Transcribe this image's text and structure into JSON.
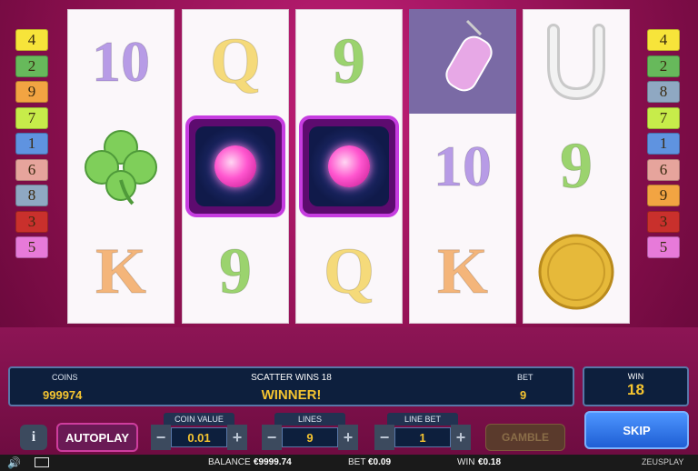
{
  "reels": [
    [
      {
        "kind": "text",
        "text": "10",
        "cls": "c10",
        "name": "symbol-10"
      },
      {
        "kind": "clover",
        "name": "clover-icon"
      },
      {
        "kind": "text",
        "text": "K",
        "cls": "cK",
        "name": "symbol-k"
      }
    ],
    [
      {
        "kind": "text",
        "text": "Q",
        "cls": "cQ",
        "name": "symbol-q"
      },
      {
        "kind": "scatter",
        "name": "crystal-ball-scatter-icon"
      },
      {
        "kind": "text",
        "text": "9",
        "cls": "c9",
        "name": "symbol-9"
      }
    ],
    [
      {
        "kind": "text",
        "text": "9",
        "cls": "c9",
        "name": "symbol-9"
      },
      {
        "kind": "scatter",
        "name": "crystal-ball-scatter-icon"
      },
      {
        "kind": "text",
        "text": "Q",
        "cls": "cQ",
        "name": "symbol-q"
      }
    ],
    [
      {
        "kind": "pendant",
        "name": "pendant-icon"
      },
      {
        "kind": "text",
        "text": "10",
        "cls": "c10",
        "name": "symbol-10"
      },
      {
        "kind": "text",
        "text": "K",
        "cls": "cK",
        "name": "symbol-k"
      }
    ],
    [
      {
        "kind": "horseshoe",
        "name": "horseshoe-icon"
      },
      {
        "kind": "text",
        "text": "9",
        "cls": "c9",
        "name": "symbol-9"
      },
      {
        "kind": "coin",
        "name": "gold-coin-icon"
      }
    ]
  ],
  "left_lines": [
    {
      "n": "4",
      "color": "#f7e43a"
    },
    {
      "n": "2",
      "color": "#67b95b"
    },
    {
      "n": "9",
      "color": "#f2a442"
    },
    {
      "n": "7",
      "color": "#c7ec4a"
    },
    {
      "n": "1",
      "color": "#5f93e0"
    },
    {
      "n": "6",
      "color": "#e6a49c"
    },
    {
      "n": "8",
      "color": "#8fa8c2"
    },
    {
      "n": "3",
      "color": "#c9302c"
    },
    {
      "n": "5",
      "color": "#e77ad9"
    }
  ],
  "right_lines": [
    {
      "n": "4",
      "color": "#f7e43a"
    },
    {
      "n": "2",
      "color": "#67b95b"
    },
    {
      "n": "8",
      "color": "#8fa8c2"
    },
    {
      "n": "7",
      "color": "#c7ec4a"
    },
    {
      "n": "1",
      "color": "#5f93e0"
    },
    {
      "n": "6",
      "color": "#e6a49c"
    },
    {
      "n": "9",
      "color": "#f2a442"
    },
    {
      "n": "3",
      "color": "#c9302c"
    },
    {
      "n": "5",
      "color": "#e77ad9"
    }
  ],
  "info": {
    "coins_label": "COINS",
    "coins_value": "999974",
    "scatter_text": "SCATTER WINS 18",
    "winner_text": "WINNER!",
    "bet_label": "BET",
    "bet_value": "9"
  },
  "win": {
    "label": "WIN",
    "value": "18"
  },
  "controls": {
    "info_label": "i",
    "autoplay": "AUTOPLAY",
    "coin_value_label": "COIN VALUE",
    "coin_value": "0.01",
    "lines_label": "LINES",
    "lines": "9",
    "line_bet_label": "LINE BET",
    "line_bet": "1",
    "gamble": "GAMBLE",
    "skip": "SKIP",
    "minus": "−",
    "plus": "+"
  },
  "status": {
    "balance_label": "BALANCE",
    "balance": "€9999.74",
    "bet_label": "BET",
    "bet": "€0.09",
    "win_label": "WIN",
    "win": "€0.18",
    "brand": "ZEUSPLAY"
  },
  "colors": {
    "accent": "#f5c430",
    "skip": "#2f7df0",
    "scatter_border": "#c63de0"
  }
}
